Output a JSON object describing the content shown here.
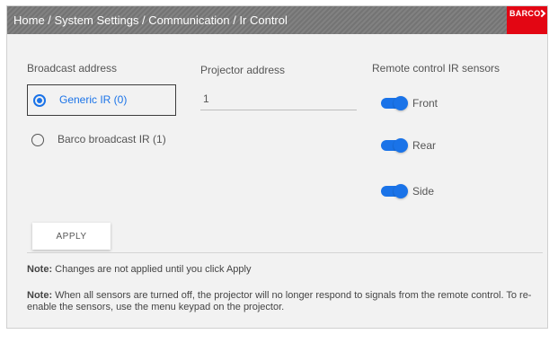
{
  "header": {
    "breadcrumb": "Home / System Settings / Communication / Ir Control",
    "logo_text": "BARCO"
  },
  "broadcast": {
    "label": "Broadcast address",
    "options": [
      {
        "label": "Generic IR (0)",
        "selected": true
      },
      {
        "label": "Barco broadcast IR (1)",
        "selected": false
      }
    ]
  },
  "projector": {
    "label": "Projector address",
    "value": "1"
  },
  "sensors": {
    "label": "Remote control IR sensors",
    "items": [
      {
        "label": "Front",
        "on": true
      },
      {
        "label": "Rear",
        "on": true
      },
      {
        "label": "Side",
        "on": true
      }
    ]
  },
  "apply_label": "APPLY",
  "notes": [
    {
      "prefix": "Note:",
      "text": " Changes are not applied until you click Apply"
    },
    {
      "prefix": "Note:",
      "text": " When all sensors are turned off, the projector will no longer respond to signals from the remote control. To re-enable the sensors, use the menu keypad on the projector."
    }
  ],
  "colors": {
    "accent": "#1a73e8",
    "brand_red": "#e30613",
    "header_bg": "#7a7a7a"
  }
}
